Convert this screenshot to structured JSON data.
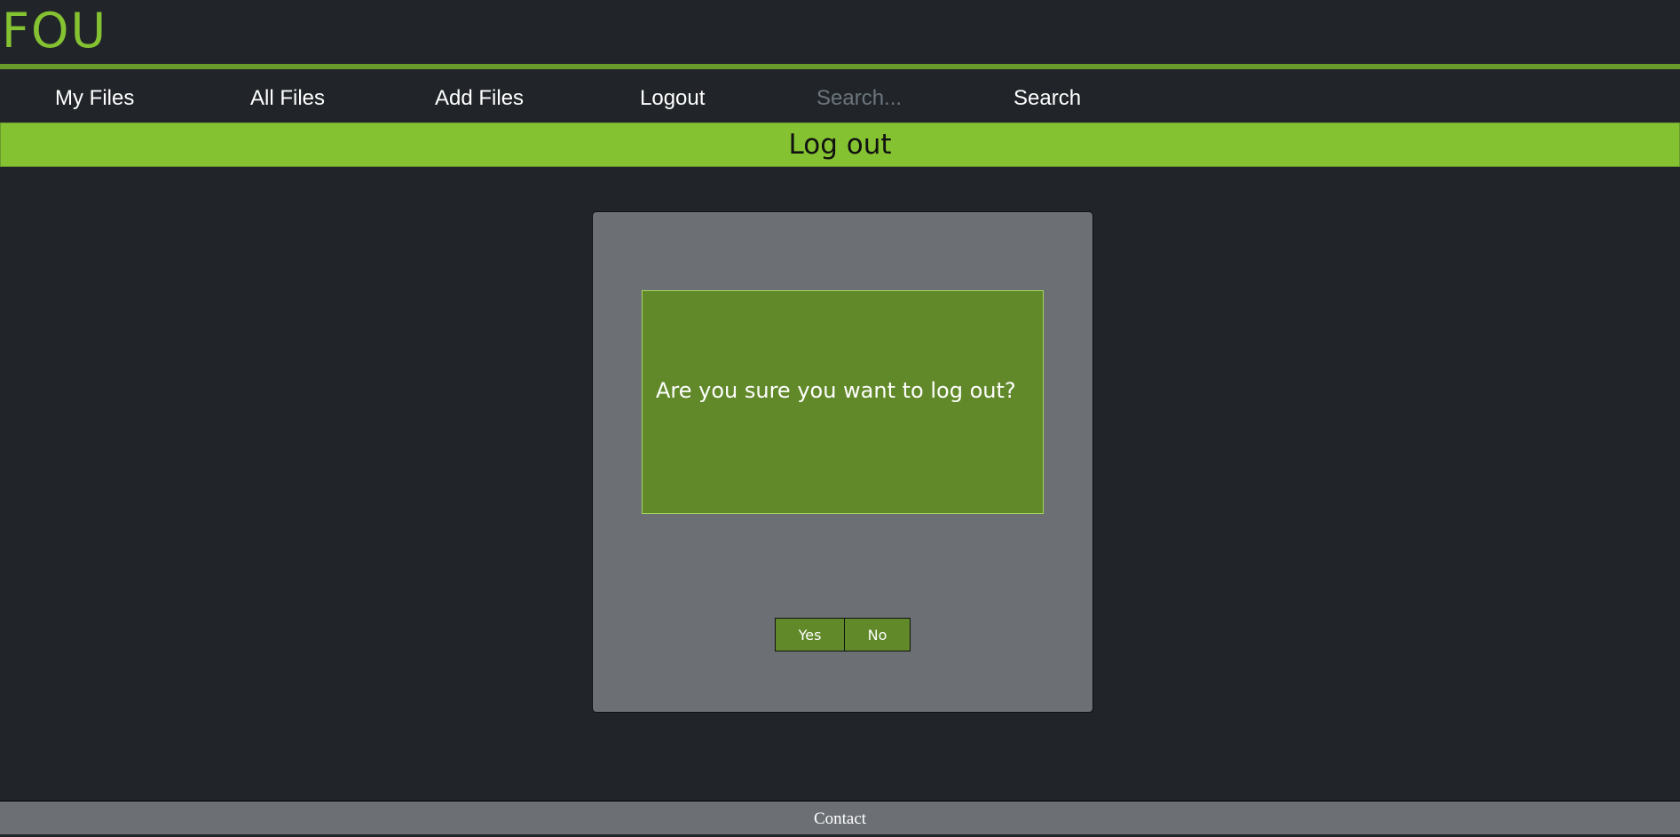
{
  "header": {
    "logo": "FOU"
  },
  "nav": {
    "items": [
      {
        "label": "My Files"
      },
      {
        "label": "All Files"
      },
      {
        "label": "Add Files"
      },
      {
        "label": "Logout"
      }
    ],
    "search": {
      "placeholder": "Search...",
      "value": "",
      "button_label": "Search"
    }
  },
  "page": {
    "title": "Log out"
  },
  "dialog": {
    "message": "Are you sure you want to log out?",
    "yes_label": "Yes",
    "no_label": "No"
  },
  "footer": {
    "contact_label": "Contact"
  },
  "colors": {
    "background": "#212529",
    "accent": "#85c232",
    "accent_dark": "#61892a",
    "panel": "#6c7074"
  }
}
